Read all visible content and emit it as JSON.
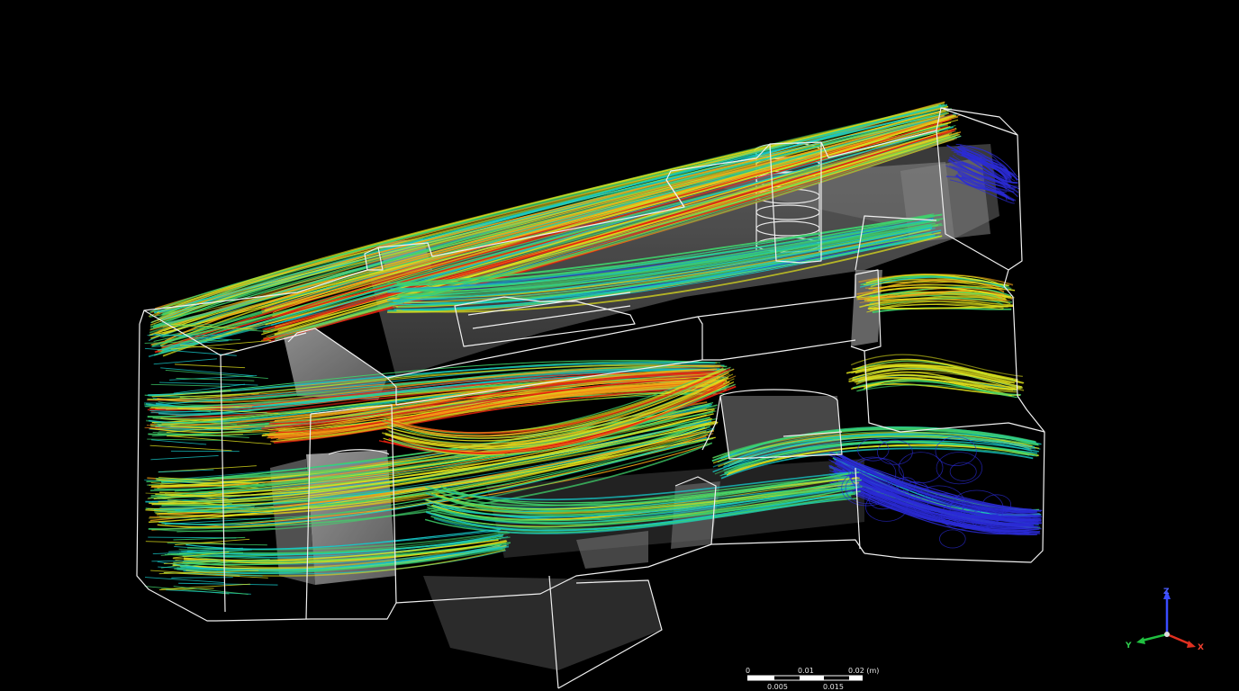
{
  "viewport": {
    "background": "#000000",
    "visualization": "streamlines",
    "colormap": [
      "#2b2bd6",
      "#16c8c8",
      "#3fd26a",
      "#dfe01b",
      "#f3a316",
      "#e8200f"
    ]
  },
  "scale_bar": {
    "top_labels": [
      "0",
      "0.01",
      "0.02 (m)"
    ],
    "bottom_labels": [
      "0.005",
      "0.015"
    ]
  },
  "triad": {
    "z_label": "Z",
    "y_label": "Y",
    "x_label": "X",
    "z_color": "#3a4cff",
    "y_color": "#20c040",
    "x_color": "#e03020"
  }
}
